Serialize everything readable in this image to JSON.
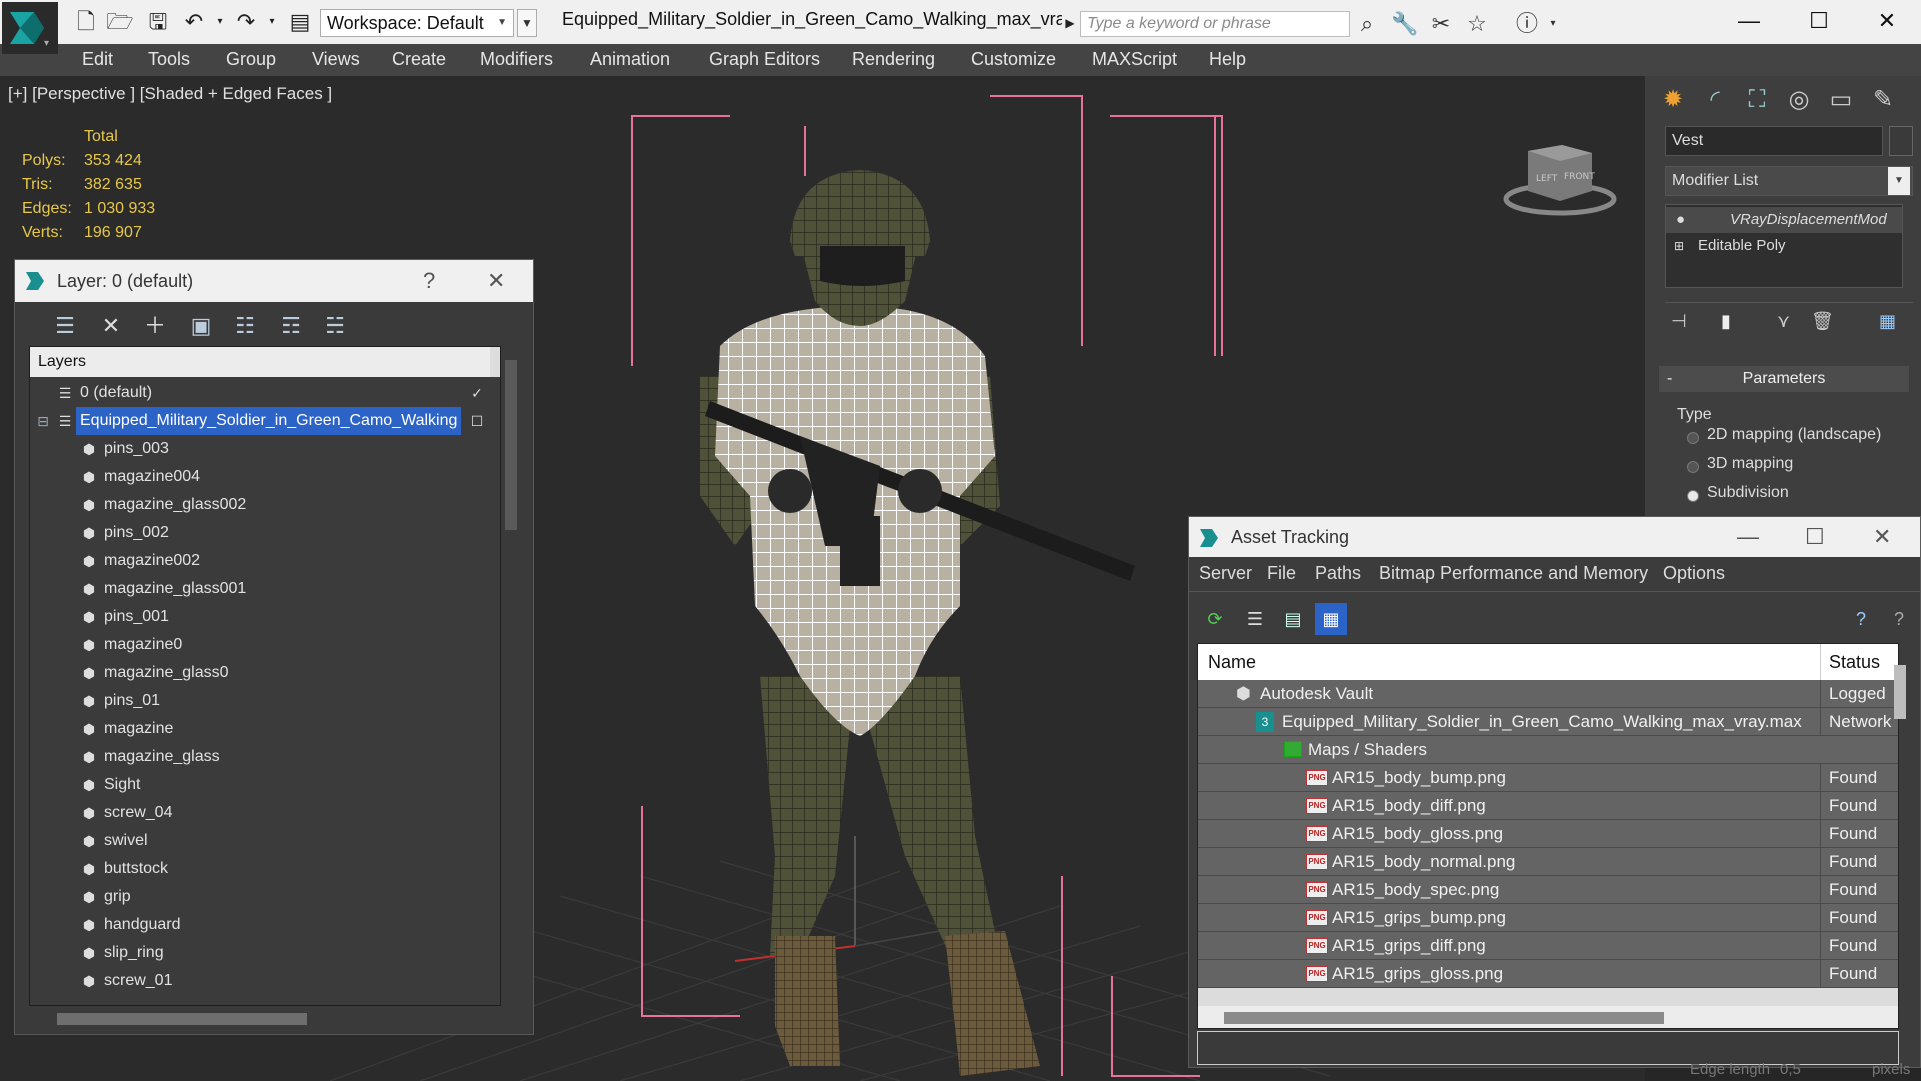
{
  "titlebar": {
    "workspace_label": "Workspace: Default",
    "document_title": "Equipped_Military_Soldier_in_Green_Camo_Walking_max_vra...",
    "search_placeholder": "Type a keyword or phrase"
  },
  "menu": [
    "Edit",
    "Tools",
    "Group",
    "Views",
    "Create",
    "Modifiers",
    "Animation",
    "Graph Editors",
    "Rendering",
    "Customize",
    "MAXScript",
    "Help"
  ],
  "viewport": {
    "label": "[+] [Perspective ] [Shaded + Edged Faces ]",
    "stats": {
      "header": "Total",
      "rows": [
        {
          "label": "Polys:",
          "value": "353 424"
        },
        {
          "label": "Tris:",
          "value": "382 635"
        },
        {
          "label": "Edges:",
          "value": "1 030 933"
        },
        {
          "label": "Verts:",
          "value": "196 907"
        }
      ]
    },
    "viewcube_left": "LEFT",
    "viewcube_front": "FRONT",
    "colors": {
      "wire": "#ffffff",
      "bbox": "#e8729a",
      "bg": "#2b2b2b"
    }
  },
  "layer_panel": {
    "title": "Layer: 0 (default)",
    "help": "?",
    "header": "Layers",
    "rows": [
      {
        "label": "0 (default)",
        "selected": false
      },
      {
        "label": "Equipped_Military_Soldier_in_Green_Camo_Walking",
        "selected": true
      },
      {
        "label": "pins_003"
      },
      {
        "label": "magazine004"
      },
      {
        "label": "magazine_glass002"
      },
      {
        "label": "pins_002"
      },
      {
        "label": "magazine002"
      },
      {
        "label": "magazine_glass001"
      },
      {
        "label": "pins_001"
      },
      {
        "label": "magazine0"
      },
      {
        "label": "magazine_glass0"
      },
      {
        "label": "pins_01"
      },
      {
        "label": "magazine"
      },
      {
        "label": "magazine_glass"
      },
      {
        "label": "Sight"
      },
      {
        "label": "screw_04"
      },
      {
        "label": "swivel"
      },
      {
        "label": "buttstock"
      },
      {
        "label": "grip"
      },
      {
        "label": "handguard"
      },
      {
        "label": "slip_ring"
      },
      {
        "label": "screw_01"
      }
    ]
  },
  "asset_tracking": {
    "title": "Asset Tracking",
    "menu": [
      "Server",
      "File",
      "Paths",
      "Bitmap Performance and Memory",
      "Options"
    ],
    "columns": {
      "name": "Name",
      "status": "Status"
    },
    "rows": [
      {
        "name": "Autodesk Vault",
        "status": "Logged",
        "indent": 1,
        "icon": "vault-icon"
      },
      {
        "name": "Equipped_Military_Soldier_in_Green_Camo_Walking_max_vray.max",
        "status": "Network",
        "indent": 2,
        "icon": "max-file-icon"
      },
      {
        "name": "Maps / Shaders",
        "status": "",
        "indent": 3,
        "icon": "maps-folder-icon"
      },
      {
        "name": "AR15_body_bump.png",
        "status": "Found",
        "indent": 4,
        "icon": "png-icon"
      },
      {
        "name": "AR15_body_diff.png",
        "status": "Found",
        "indent": 4,
        "icon": "png-icon"
      },
      {
        "name": "AR15_body_gloss.png",
        "status": "Found",
        "indent": 4,
        "icon": "png-icon"
      },
      {
        "name": "AR15_body_normal.png",
        "status": "Found",
        "indent": 4,
        "icon": "png-icon"
      },
      {
        "name": "AR15_body_spec.png",
        "status": "Found",
        "indent": 4,
        "icon": "png-icon"
      },
      {
        "name": "AR15_grips_bump.png",
        "status": "Found",
        "indent": 4,
        "icon": "png-icon"
      },
      {
        "name": "AR15_grips_diff.png",
        "status": "Found",
        "indent": 4,
        "icon": "png-icon"
      },
      {
        "name": "AR15_grips_gloss.png",
        "status": "Found",
        "indent": 4,
        "icon": "png-icon"
      }
    ]
  },
  "command_panel": {
    "object_name": "Vest",
    "modifier_list": "Modifier List",
    "stack": [
      "VRayDisplacementMod",
      "Editable Poly"
    ],
    "parameters_header": "Parameters",
    "collapse": "-",
    "type_label": "Type",
    "options": [
      {
        "label": "2D mapping (landscape)",
        "selected": false
      },
      {
        "label": "3D mapping",
        "selected": false
      },
      {
        "label": "Subdivision",
        "selected": true
      }
    ]
  },
  "status_bar": {
    "edge_length_label": "Edge length",
    "edge_length_value": "0,5",
    "unit": "pixels"
  }
}
